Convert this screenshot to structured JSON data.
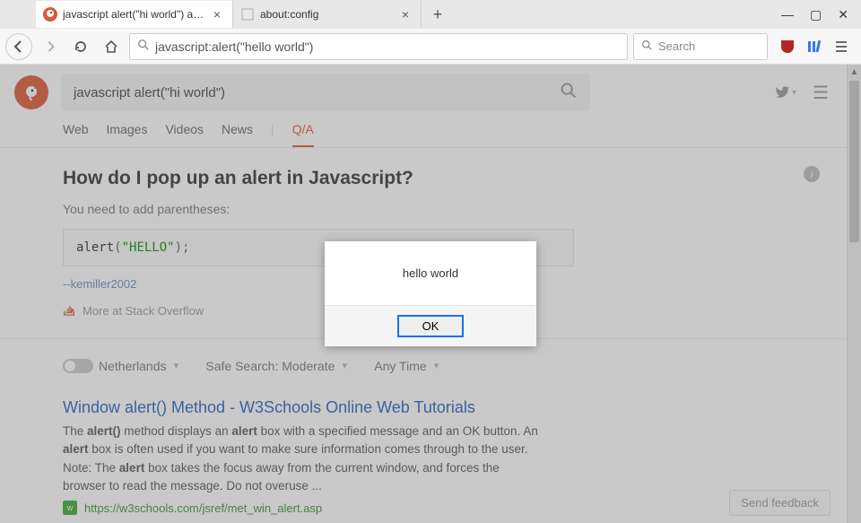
{
  "tabs": [
    {
      "title": "javascript alert(\"hi world\") at D"
    },
    {
      "title": "about:config"
    }
  ],
  "toolbar": {
    "url_value": "javascript:alert(\"hello world\")",
    "search_placeholder": "Search"
  },
  "ddg": {
    "query": "javascript alert(\"hi world\")",
    "navTabs": {
      "web": "Web",
      "images": "Images",
      "videos": "Videos",
      "news": "News",
      "qa": "Q/A"
    },
    "answer": {
      "title": "How do I pop up an alert in Javascript?",
      "subtitle": "You need to add parentheses:",
      "code_fn": "alert",
      "code_paren_open": "(",
      "code_str": "\"HELLO\"",
      "code_close": ");",
      "author": "--kemiller2002",
      "more": "More at Stack Overflow"
    },
    "filters": {
      "region": "Netherlands",
      "safesearch": "Safe Search: Moderate",
      "time": "Any Time"
    },
    "result1": {
      "title": "Window alert() Method - W3Schools Online Web Tutorials",
      "snippet_parts": [
        "The ",
        "alert()",
        " method displays an ",
        "alert",
        " box with a specified message and an OK button. An ",
        "alert",
        " box is often used if you want to make sure information comes through to the user. Note: The ",
        "alert",
        " box takes the focus away from the current window, and forces the browser to read the message. Do not overuse ..."
      ],
      "url": "https://w3schools.com/jsref/met_win_alert.asp"
    },
    "feedback": "Send feedback"
  },
  "alert_dialog": {
    "message": "hello world",
    "ok": "OK"
  }
}
